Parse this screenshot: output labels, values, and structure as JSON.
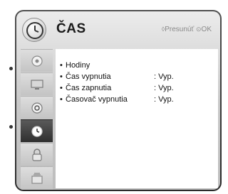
{
  "header": {
    "title": "ČAS",
    "hint_move_symbol": "◊",
    "hint_move": "Presunúť",
    "hint_ok_symbol": "⊙",
    "hint_ok": "OK"
  },
  "sidebar": {
    "items": [
      {
        "icon": "picture-icon"
      },
      {
        "icon": "monitor-icon"
      },
      {
        "icon": "sound-icon"
      },
      {
        "icon": "clock-icon",
        "active": true
      },
      {
        "icon": "lock-icon"
      },
      {
        "icon": "option-icon"
      }
    ]
  },
  "menu": {
    "bullet": "•",
    "items": [
      {
        "label": "Hodiny",
        "value": ""
      },
      {
        "label": "Čas vypnutia",
        "value": ": Vyp."
      },
      {
        "label": "Čas zapnutia",
        "value": ": Vyp."
      },
      {
        "label": "Časovač vypnutia",
        "value": ": Vyp."
      }
    ]
  }
}
